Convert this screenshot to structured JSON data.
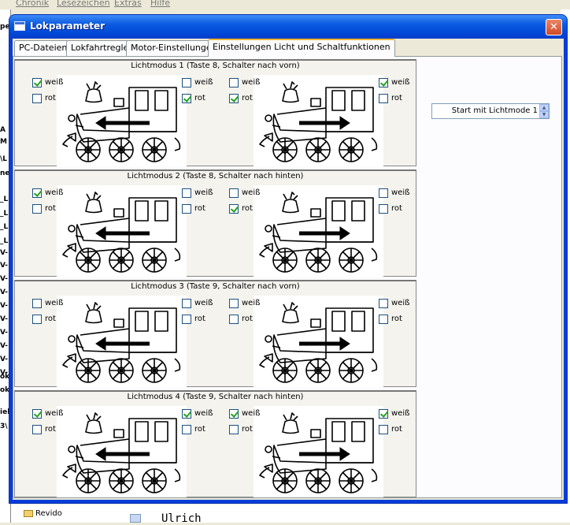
{
  "background_app": {
    "menu": [
      "Chronik",
      "Lesezeichen",
      "Extras",
      "Hilfe"
    ],
    "left_strip": [
      "pe",
      "A",
      "M",
      "\\L",
      "ne",
      "_L",
      "_L",
      "_L",
      "_L",
      "V-",
      "V-",
      "V-",
      "V-",
      "V-",
      "V-",
      "V-",
      "V-",
      "V-",
      "V-",
      "ok",
      "ok",
      "iek",
      "3\\"
    ],
    "tree_item": "Revido",
    "bottom_text": "Ulrich"
  },
  "window": {
    "title": "Lokparameter",
    "close": "✕"
  },
  "tabs": [
    {
      "label": "PC-Dateien"
    },
    {
      "label": "Lokfahrtregler"
    },
    {
      "label": "Motor-Einstellungen"
    },
    {
      "label": "Einstellungen Licht und Schaltfunktionen"
    }
  ],
  "start_mode": {
    "value": "Start mit Lichtmode 1"
  },
  "labels": {
    "white": "weiß",
    "red": "rot"
  },
  "modes": [
    {
      "title": "Lichtmodus 1 (Taste 8, Schalter nach vorn)",
      "lok_left": {
        "front": {
          "white": true,
          "red": false
        },
        "rear": {
          "white": false,
          "red": true
        }
      },
      "lok_right": {
        "front": {
          "white": false,
          "red": true
        },
        "rear": {
          "white": true,
          "red": false
        }
      }
    },
    {
      "title": "Lichtmodus 2 (Taste 8, Schalter nach hinten)",
      "lok_left": {
        "front": {
          "white": true,
          "red": false
        },
        "rear": {
          "white": false,
          "red": false
        }
      },
      "lok_right": {
        "front": {
          "white": false,
          "red": true
        },
        "rear": {
          "white": false,
          "red": false
        }
      }
    },
    {
      "title": "Lichtmodus 3 (Taste 9, Schalter nach vorn)",
      "lok_left": {
        "front": {
          "white": false,
          "red": false
        },
        "rear": {
          "white": false,
          "red": false
        }
      },
      "lok_right": {
        "front": {
          "white": false,
          "red": false
        },
        "rear": {
          "white": false,
          "red": false
        }
      }
    },
    {
      "title": "Lichtmodus 4 (Taste 9, Schalter nach hinten)",
      "lok_left": {
        "front": {
          "white": true,
          "red": false
        },
        "rear": {
          "white": true,
          "red": false
        }
      },
      "lok_right": {
        "front": {
          "white": true,
          "red": false
        },
        "rear": {
          "white": true,
          "red": false
        }
      }
    }
  ],
  "icons": {
    "loco_left": "locomotive-arrow-left-icon",
    "loco_right": "locomotive-arrow-right-icon"
  }
}
